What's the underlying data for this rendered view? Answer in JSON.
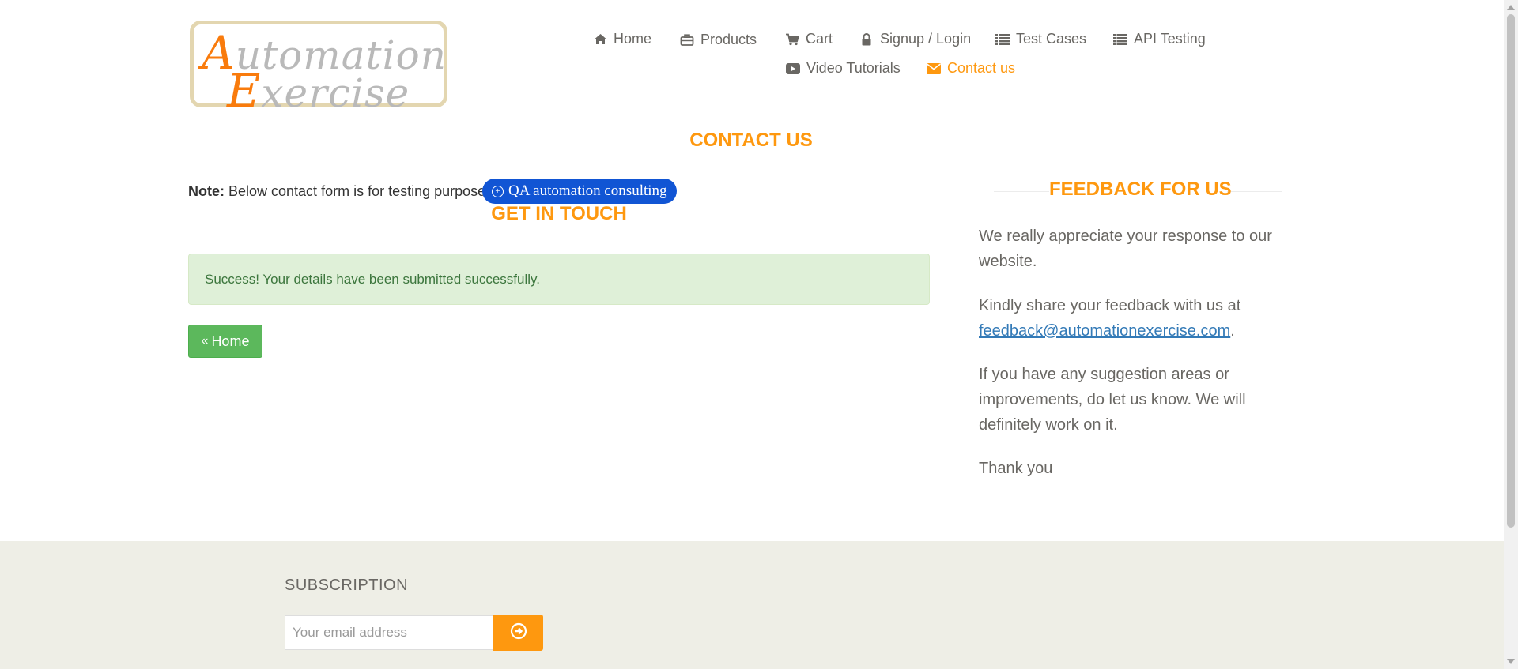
{
  "logo": {
    "line1_initial": "A",
    "line1_rest": "utomation",
    "line2_initial": "E",
    "line2_rest": "xercise"
  },
  "nav": {
    "home": "Home",
    "products": "Products",
    "cart": "Cart",
    "signup_login": "Signup / Login",
    "test_cases": "Test Cases",
    "api_testing": "API Testing",
    "video_tutorials": "Video Tutorials",
    "contact_us": "Contact us"
  },
  "main": {
    "contact_title": "CONTACT US",
    "note_label": "Note:",
    "note_text": " Below contact form is for testing purpose.",
    "qa_badge": "QA automation consulting",
    "get_in_touch": "GET IN TOUCH",
    "success_message": "Success! Your details have been submitted successfully.",
    "home_button": "Home"
  },
  "feedback": {
    "title": "FEEDBACK FOR US",
    "p1": "We really appreciate your response to our website.",
    "p2_text": "Kindly share your feedback with us at ",
    "p2_email": "feedback@automationexercise.com",
    "p2_end": ".",
    "p3": "If you have any suggestion areas or improvements, do let us know. We will definitely work on it.",
    "p4": "Thank you"
  },
  "footer": {
    "subscription_title": "SUBSCRIPTION",
    "email_placeholder": "Your email address"
  },
  "colors": {
    "accent": "#fe980f",
    "success_bg": "#dff0d8",
    "home_btn": "#5cb85c",
    "badge": "#1155d4",
    "footer_bg": "#eeeee6"
  }
}
